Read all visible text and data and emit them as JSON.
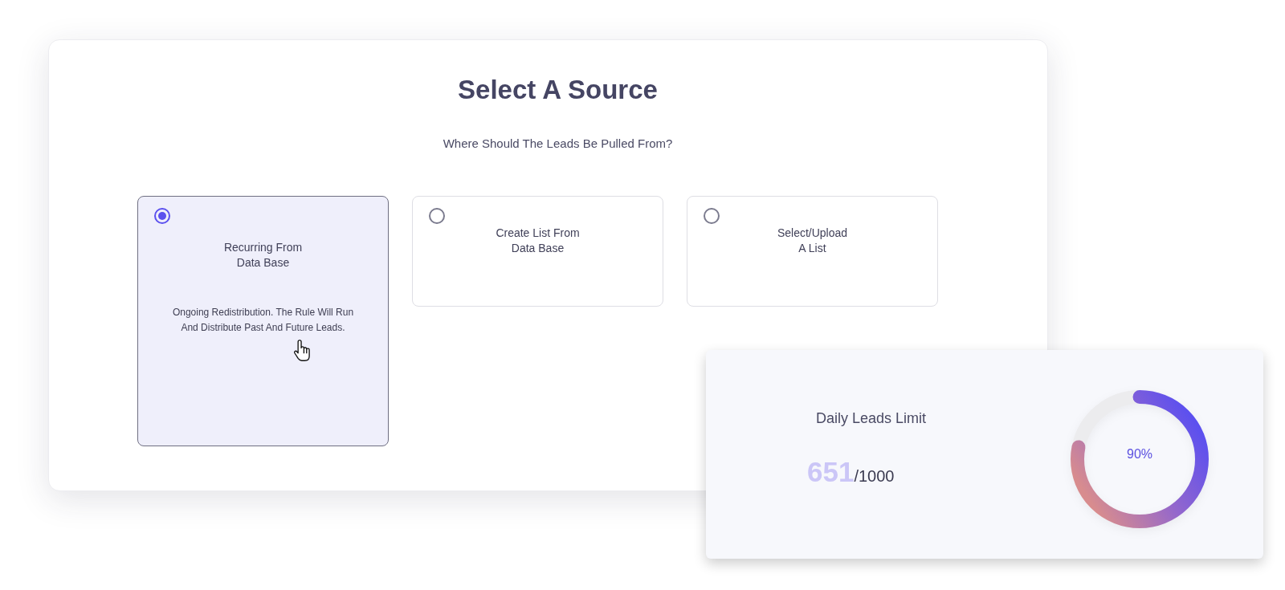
{
  "dialog": {
    "title": "Select A Source",
    "subtitle": "Where Should The Leads Be Pulled From?"
  },
  "sources": [
    {
      "title": "Recurring From\nData Base",
      "description": "Ongoing Redistribution. The Rule Will Run\nAnd Distribute Past And Future Leads.",
      "selected": true
    },
    {
      "title": "Create List From\nData Base",
      "selected": false
    },
    {
      "title": "Select/Upload\nA List",
      "selected": false
    }
  ],
  "limit": {
    "label": "Daily Leads Limit",
    "used": "651",
    "total": "/1000",
    "ring": {
      "level": 0.78,
      "reading": "90%"
    }
  }
}
